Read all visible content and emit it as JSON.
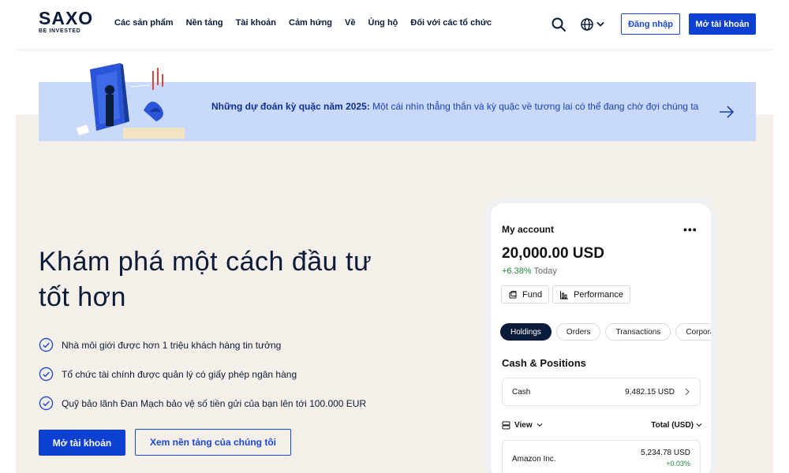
{
  "header": {
    "logo": {
      "word": "SAXO",
      "tagline": "BE INVESTED"
    },
    "nav": [
      {
        "label": "Các sản phẩm"
      },
      {
        "label": "Nền tảng"
      },
      {
        "label": "Tài khoản"
      },
      {
        "label": "Cảm hứng"
      },
      {
        "label": "Về"
      },
      {
        "label": "Ủng hộ"
      },
      {
        "label": "Đối với các tổ chức"
      }
    ],
    "search_icon": "search-icon",
    "language_icon": "globe-icon",
    "login_label": "Đăng nhập",
    "open_account_label": "Mở tài khoản"
  },
  "banner": {
    "bold": "Những dự đoán kỳ quặc năm 2025:",
    "text": " Một cái nhìn thẳng thắn và kỳ quặc về tương lai có thể đang chờ đợi chúng ta",
    "arrow_icon": "arrow-right-icon"
  },
  "hero": {
    "title": "Khám phá một cách đầu tư tốt hơn",
    "features": [
      {
        "text": "Nhà môi giới được hơn 1 triệu khách hàng tin tưởng"
      },
      {
        "text": "Tổ chức tài chính được quản lý có giấy phép ngân hàng"
      },
      {
        "text": "Quỹ bảo lãnh Đan Mạch bảo vệ số tiền gửi của bạn lên tới 100.000 EUR"
      }
    ],
    "open_account_label": "Mở tài khoản",
    "platform_label": "Xem nền tảng của chúng tôi"
  },
  "account": {
    "title": "My account",
    "more": "•••",
    "balance": "20,000.00 USD",
    "change_pct": "+6.38%",
    "change_period": "Today",
    "chips": [
      {
        "label": "Fund",
        "icon": "fund-icon"
      },
      {
        "label": "Performance",
        "icon": "chart-icon"
      }
    ],
    "tabs": [
      {
        "label": "Holdings",
        "active": true
      },
      {
        "label": "Orders",
        "active": false
      },
      {
        "label": "Transactions",
        "active": false
      },
      {
        "label": "Corporate",
        "active": false
      }
    ],
    "section_title": "Cash & Positions",
    "cash": {
      "label": "Cash",
      "value": "9,482.15 USD"
    },
    "view_label": "View",
    "total_label": "Total (USD)",
    "holding": {
      "name": "Amazon Inc.",
      "amount": "5,234.78 USD",
      "change": "+0.03%"
    }
  },
  "colors": {
    "brand_blue": "#0d3fd1",
    "navy": "#0b1b3a",
    "banner_bg": "#c9d9fb",
    "hero_bg": "#f4efe8",
    "positive": "#1f8b3e"
  }
}
